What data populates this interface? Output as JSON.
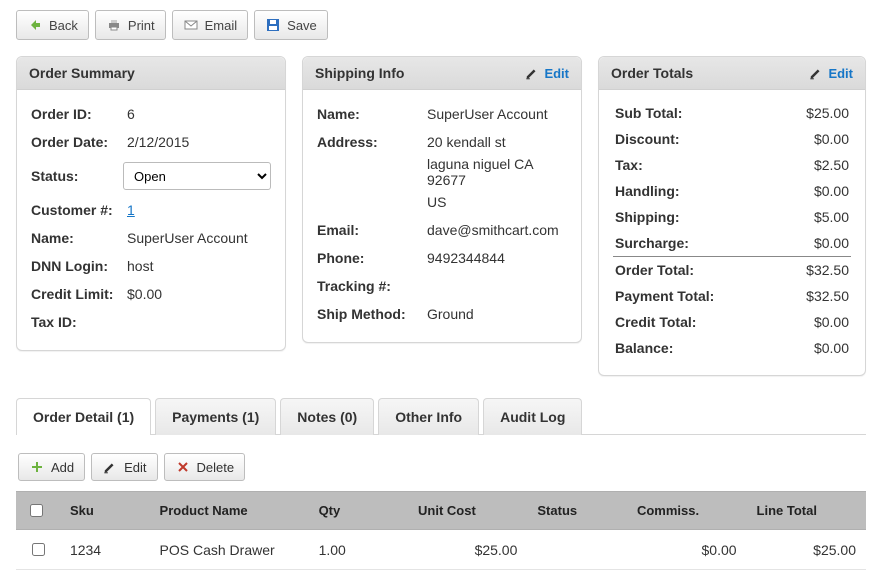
{
  "toolbar": {
    "back": "Back",
    "print": "Print",
    "email": "Email",
    "save": "Save"
  },
  "summary": {
    "title": "Order Summary",
    "order_id_label": "Order ID:",
    "order_id": "6",
    "order_date_label": "Order Date:",
    "order_date": "2/12/2015",
    "status_label": "Status:",
    "status_value": "Open",
    "customer_no_label": "Customer #:",
    "customer_no": "1",
    "name_label": "Name:",
    "name": "SuperUser Account",
    "dnn_login_label": "DNN Login:",
    "dnn_login": "host",
    "credit_limit_label": "Credit Limit:",
    "credit_limit": "$0.00",
    "tax_id_label": "Tax ID:",
    "tax_id": ""
  },
  "shipping": {
    "title": "Shipping Info",
    "edit": "Edit",
    "name_label": "Name:",
    "name": "SuperUser Account",
    "address_label": "Address:",
    "address_line1": "20 kendall st",
    "address_line2": "laguna niguel  CA  92677",
    "address_line3": "US",
    "email_label": "Email:",
    "email": "dave@smithcart.com",
    "phone_label": "Phone:",
    "phone": "9492344844",
    "tracking_label": "Tracking #:",
    "tracking": "",
    "method_label": "Ship Method:",
    "method": "Ground"
  },
  "totals": {
    "title": "Order Totals",
    "edit": "Edit",
    "sub_total_label": "Sub Total:",
    "sub_total": "$25.00",
    "discount_label": "Discount:",
    "discount": "$0.00",
    "tax_label": "Tax:",
    "tax": "$2.50",
    "handling_label": "Handling:",
    "handling": "$0.00",
    "shipping_label": "Shipping:",
    "shipping": "$5.00",
    "surcharge_label": "Surcharge:",
    "surcharge": "$0.00",
    "order_total_label": "Order Total:",
    "order_total": "$32.50",
    "payment_total_label": "Payment Total:",
    "payment_total": "$32.50",
    "credit_total_label": "Credit Total:",
    "credit_total": "$0.00",
    "balance_label": "Balance:",
    "balance": "$0.00"
  },
  "tabs": {
    "order_detail": "Order Detail (1)",
    "payments": "Payments (1)",
    "notes": "Notes (0)",
    "other_info": "Other Info",
    "audit_log": "Audit Log"
  },
  "grid_actions": {
    "add": "Add",
    "edit": "Edit",
    "delete": "Delete"
  },
  "grid": {
    "headers": {
      "sku": "Sku",
      "product_name": "Product Name",
      "qty": "Qty",
      "unit_cost": "Unit Cost",
      "status": "Status",
      "commiss": "Commiss.",
      "line_total": "Line Total"
    },
    "rows": [
      {
        "sku": "1234",
        "product_name": "POS Cash Drawer",
        "qty": "1.00",
        "unit_cost": "$25.00",
        "status": "",
        "commiss": "$0.00",
        "line_total": "$25.00"
      }
    ]
  }
}
